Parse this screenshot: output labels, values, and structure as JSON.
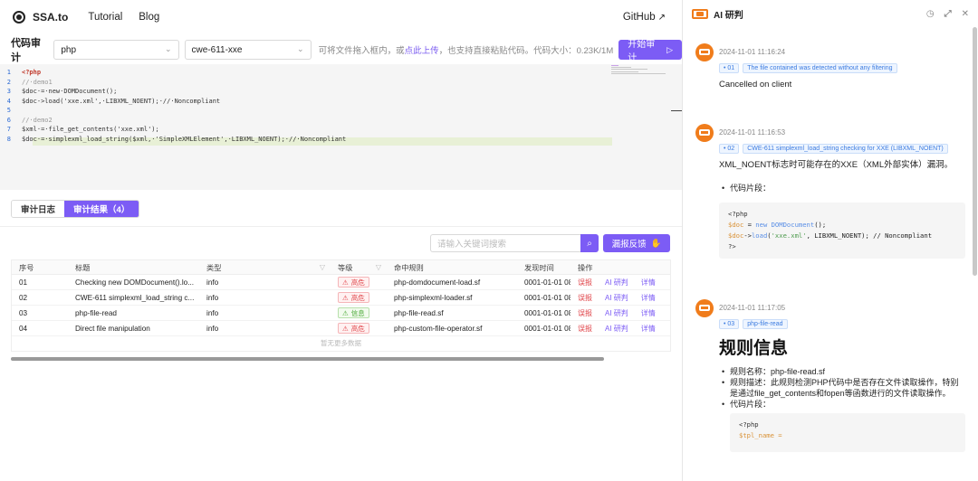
{
  "nav": {
    "brand": "SSA.to",
    "links": [
      "Tutorial",
      "Blog"
    ],
    "github": "GitHub"
  },
  "toolbar": {
    "label": "代码审计",
    "language": "php",
    "rule": "cwe-611-xxe",
    "hint_prefix": "可将文件拖入框内，或",
    "hint_link": "点此上传",
    "hint_suffix": "，也支持直接粘贴代码。代码大小：0.23K/1M",
    "start_button": "开始审计"
  },
  "editor": {
    "lines": [
      {
        "n": "1",
        "text": "<?php"
      },
      {
        "n": "2",
        "text": "//·demo1"
      },
      {
        "n": "3",
        "text": "$doc·=·new·DOMDocument();"
      },
      {
        "n": "4",
        "text": "$doc->load('xxe.xml',·LIBXML_NOENT);·//·Noncompliant"
      },
      {
        "n": "5",
        "text": ""
      },
      {
        "n": "6",
        "text": "//·demo2"
      },
      {
        "n": "7",
        "text": "$xml·=·file_get_contents('xxe.xml');"
      },
      {
        "n": "8",
        "text": "$doc·=·simplexml_load_string($xml,·'SimpleXMLElement',·LIBXML_NOENT);·//·Noncompliant"
      }
    ]
  },
  "tabs": {
    "log": "审计日志",
    "results": "审计结果（4）"
  },
  "search": {
    "placeholder": "请输入关键词搜索",
    "feedback": "漏报反馈"
  },
  "table": {
    "headers": [
      "序号",
      "标题",
      "类型",
      "等级",
      "命中规则",
      "发现时间",
      "操作"
    ],
    "rows": [
      {
        "id": "01",
        "title": "Checking new DOMDocument().lo...",
        "type": "info",
        "level": "高危",
        "level_kind": "high",
        "rule": "php-domdocument-load.sf",
        "time": "0001-01-01 08:00"
      },
      {
        "id": "02",
        "title": "CWE-611 simplexml_load_string c...",
        "type": "info",
        "level": "高危",
        "level_kind": "high",
        "rule": "php-simplexml-loader.sf",
        "time": "0001-01-01 08:00"
      },
      {
        "id": "03",
        "title": "php-file-read",
        "type": "info",
        "level": "信息",
        "level_kind": "info",
        "rule": "php-file-read.sf",
        "time": "0001-01-01 08:00"
      },
      {
        "id": "04",
        "title": "Direct file manipulation",
        "type": "info",
        "level": "高危",
        "level_kind": "high",
        "rule": "php-custom-file-operator.sf",
        "time": "0001-01-01 08:00"
      }
    ],
    "actions": [
      "误报",
      "AI 研判",
      "详情"
    ],
    "footer": "暂无更多数据"
  },
  "panel": {
    "title": "AI 研判",
    "messages": [
      {
        "time": "2024-11-01 11:16:24",
        "num": "• 01",
        "tag": "The file contained was detected without any filtering",
        "text": "Cancelled on client"
      },
      {
        "time": "2024-11-01 11:16:53",
        "num": "• 02",
        "tag": "CWE-611 simplexml_load_string checking for XXE (LIBXML_NOENT)",
        "text": "XML_NOENT标志时可能存在的XXE（XML外部实体）漏洞。",
        "bullet": "代码片段：",
        "code": [
          "<?php",
          "$doc = new DOMDocument();",
          "$doc->load('xxe.xml', LIBXML_NOENT); // Noncompliant",
          "?>"
        ]
      },
      {
        "time": "2024-11-01 11:17:05",
        "num": "• 03",
        "tag": "php-file-read",
        "heading": "规则信息",
        "bullets": [
          "规则名称：php-file-read.sf",
          "规则描述：此规则检测PHP代码中是否存在文件读取操作，特别是通过file_get_contents和fopen等函数进行的文件读取操作。",
          "代码片段："
        ],
        "code": [
          "<?php",
          "$tpl_name ="
        ]
      }
    ]
  },
  "colors": {
    "accent": "#7c5cf5",
    "brand_orange": "#f07c1b",
    "danger": "#e0464b",
    "success": "#4dab3a"
  }
}
